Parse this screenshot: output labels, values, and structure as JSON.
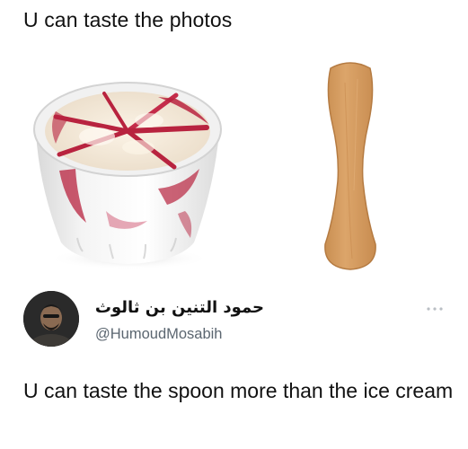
{
  "post": {
    "caption": "U can taste the photos"
  },
  "images": {
    "left": {
      "icon": "ice-cream-cup-icon"
    },
    "right": {
      "icon": "wooden-spoon-icon"
    }
  },
  "tweet": {
    "display_name": "حمود التنين بن ثالوث",
    "handle": "@HumoudMosabih",
    "text": "U can taste the spoon more than the ice cream",
    "avatar_icon": "avatar",
    "more_icon": "more-options-icon"
  },
  "colors": {
    "text": "#111111",
    "handle": "#5b6670",
    "more_dots": "#b9bec4",
    "spoon": "#d9a56a",
    "sauce": "#b8233f"
  }
}
